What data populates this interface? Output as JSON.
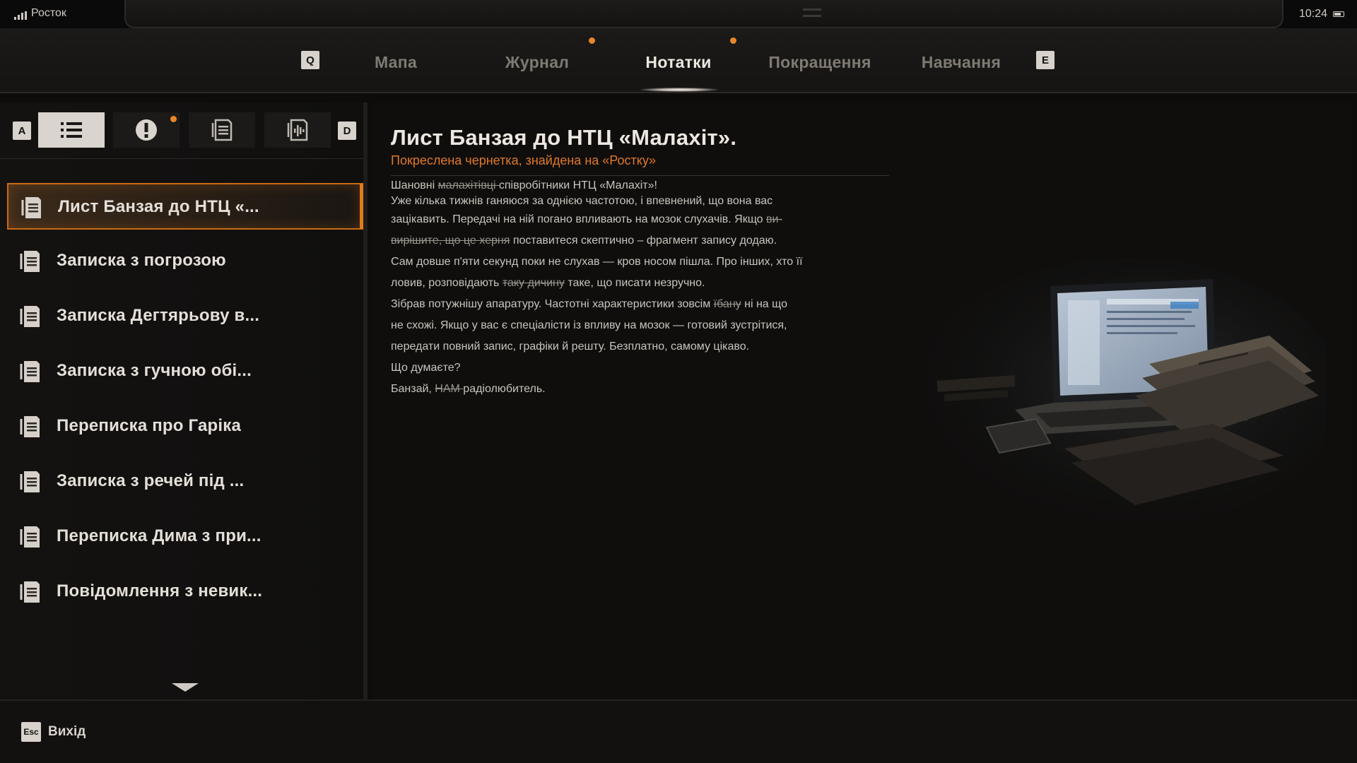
{
  "status": {
    "location": "Росток",
    "time": "10:24"
  },
  "nav": {
    "left_key": "Q",
    "right_key": "E",
    "tabs": [
      {
        "label": "Мапа"
      },
      {
        "label": "Журнал"
      },
      {
        "label": "Нотатки",
        "active": true
      },
      {
        "label": "Покращення"
      },
      {
        "label": "Навчання"
      }
    ]
  },
  "filters": {
    "left_key": "A",
    "right_key": "D",
    "items": [
      "list-icon",
      "exclamation-icon",
      "document-icon",
      "audio-icon"
    ]
  },
  "notes": {
    "items": [
      {
        "label": "Лист Банзая до НТЦ «..."
      },
      {
        "label": "Записка з погрозою"
      },
      {
        "label": "Записка Дегтярьову в..."
      },
      {
        "label": "Записка з гучною обі..."
      },
      {
        "label": "Переписка про Гаріка"
      },
      {
        "label": "Записка з речей під ..."
      },
      {
        "label": "Переписка Дима з при..."
      },
      {
        "label": "Повідомлення з невик..."
      }
    ]
  },
  "detail": {
    "title": "Лист Банзая до НТЦ «Малахіт».",
    "subtitle": "Покреслена чернетка, знайдена на «Ростку»",
    "body": {
      "l1_a": "Шановні ",
      "l1_strike": "малахітівці ",
      "l1_b": "співробітники НТЦ «Малахіт»!",
      "l2": "Уже кілька тижнів ганяюся за однією частотою, і впевнений, що вона вас",
      "l3_a": "зацікавить. Передачі на ній погано впливають на мозок слухачів. Якщо ",
      "l3_strike": "ви-",
      "l4_strike": "вирішите, що це херня",
      "l4_b": " поставитеся скептично – фрагмент запису додаю.",
      "l5": "Сам довше п'яти секунд поки не слухав — кров носом пішла. Про інших, хто її",
      "l6_a": "ловив, розповідають ",
      "l6_strike": "таку дичину",
      "l6_b": " таке, що писати незручно.",
      "l7_a": "Зібрав потужнішу апаратуру. Частотні характеристики зовсім ",
      "l7_strike": "їбану",
      "l7_b": " ні на що",
      "l8": "не схожі. Якщо у вас є спеціалісти із впливу на мозок — готовий зустрітися,",
      "l9": "передати повний запис, графіки й решту. Безплатно, самому цікаво.",
      "l10": "Що думаєте?",
      "l11_a": "Банзай, ",
      "l11_strike": "НАМ ",
      "l11_b": "радіолюбитель."
    }
  },
  "footer": {
    "esc_key": "Esc",
    "exit_label": "Вихід"
  },
  "colors": {
    "accent": "#e8872a",
    "subtitle": "#e0782a",
    "active_border": "#c96a14"
  }
}
